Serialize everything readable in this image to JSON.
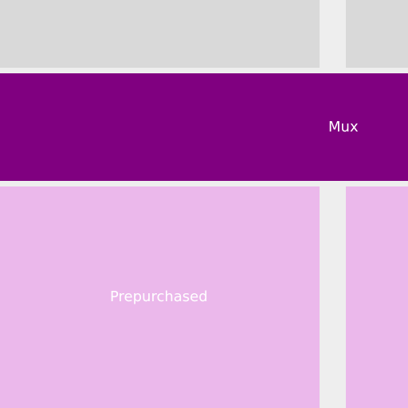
{
  "bands": {
    "mux": {
      "label": "Mux",
      "color": "#800080"
    },
    "prepurchased": {
      "label": "Prepurchased",
      "color": "#ebb8eb"
    }
  },
  "colors": {
    "background": "#eeeeee",
    "top_block": "#d9d9d9",
    "label_text": "#ffffff"
  }
}
